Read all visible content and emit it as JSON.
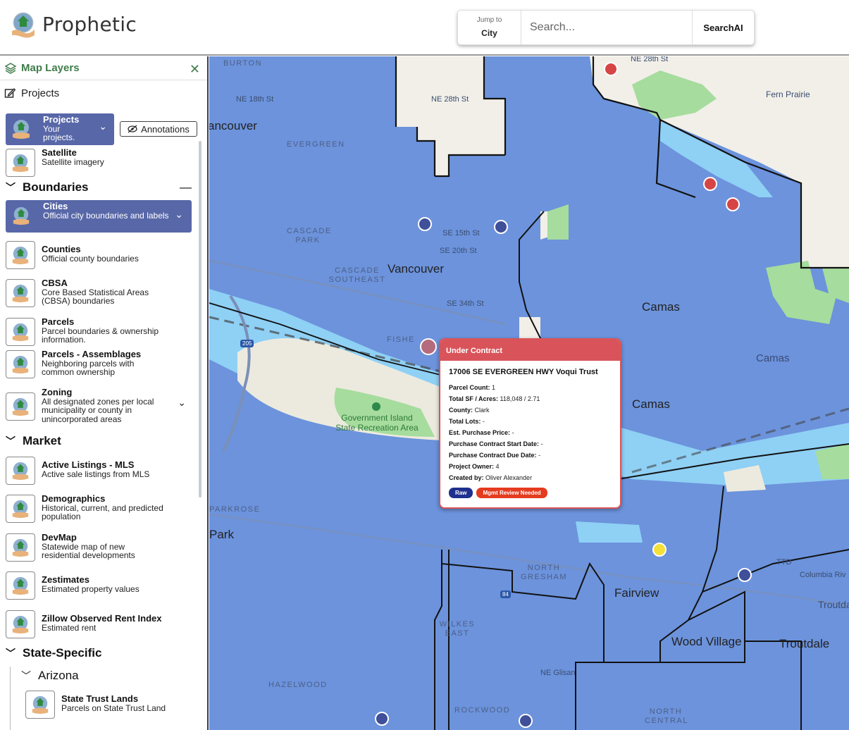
{
  "header": {
    "brand": "Prophetic",
    "jump_label": "Jump to",
    "jump_value": "City",
    "search_placeholder": "Search...",
    "searchai_label": "SearchAI"
  },
  "sidebar": {
    "title": "Map Layers",
    "projects_link": "Projects",
    "projects_layer": {
      "name": "Projects",
      "desc": "Your projects."
    },
    "annotations_button": "Annotations",
    "satellite": {
      "name": "Satellite",
      "desc": "Satellite imagery"
    },
    "sections": {
      "boundaries": "Boundaries",
      "market": "Market",
      "state_specific": "State-Specific",
      "arizona": "Arizona"
    },
    "boundaries": [
      {
        "name": "Cities",
        "desc": "Official city boundaries and labels"
      },
      {
        "name": "Counties",
        "desc": "Official county boundaries"
      },
      {
        "name": "CBSA",
        "desc": "Core Based Statistical Areas (CBSA) boundaries"
      },
      {
        "name": "Parcels",
        "desc": "Parcel boundaries & ownership information."
      },
      {
        "name": "Parcels - Assemblages",
        "desc": "Neighboring parcels with common ownership"
      },
      {
        "name": "Zoning",
        "desc": "All designated zones per local municipality or county in unincorporated areas"
      }
    ],
    "market": [
      {
        "name": "Active Listings - MLS",
        "desc": "Active sale listings from MLS"
      },
      {
        "name": "Demographics",
        "desc": "Historical, current, and predicted population"
      },
      {
        "name": "DevMap",
        "desc": "Statewide map of new residential developments"
      },
      {
        "name": "Zestimates",
        "desc": "Estimated property values"
      },
      {
        "name": "Zillow Observed Rent Index",
        "desc": "Estimated rent"
      }
    ],
    "arizona": [
      {
        "name": "State Trust Lands",
        "desc": "Parcels on State Trust Land"
      }
    ]
  },
  "map": {
    "labels": {
      "burton": "BURTON",
      "ne18": "NE 18th St",
      "ne28": "NE 28th St",
      "ne28b": "NE 28th St",
      "fern": "Fern Prairie",
      "vancouver_l": "ancouver",
      "evergreen": "EVERGREEN",
      "cascade": "CASCADE PARK",
      "se15": "SE 15th St",
      "se20": "SE 20th St",
      "vancouver": "Vancouver",
      "cascade_se": "CASCADE SOUTHEAST",
      "se34": "SE 34th St",
      "camas1": "Camas",
      "camas2": "Camas",
      "camas3": "Camas",
      "fisher": "FISHE",
      "govisland": "Government Island State Recreation Area",
      "parkrose": "PARKROSE",
      "park": "Park",
      "north_gresham": "NORTH GRESHAM",
      "fairview": "Fairview",
      "wilkes": "WILKES EAST",
      "wood_village": "Wood Village",
      "troutdale": "Troutdale",
      "troutdale2": "Troutdale",
      "ttd": "TTD",
      "columbia": "Columbia Riv",
      "ne_glisan": "NE Glisan",
      "hazelwood": "HAZELWOOD",
      "rockwood": "ROCKWOOD",
      "north_central": "NORTH CENTRAL",
      "i205": "205",
      "i84": "84"
    }
  },
  "popup": {
    "status": "Under Contract",
    "title": "17006 SE EVERGREEN HWY Voqui Trust",
    "rows": [
      {
        "label": "Parcel Count:",
        "value": "1"
      },
      {
        "label": "Total SF / Acres:",
        "value": "118,048 / 2.71"
      },
      {
        "label": "County:",
        "value": "Clark"
      },
      {
        "label": "Total Lots:",
        "value": "-"
      },
      {
        "label": "Est. Purchase Price:",
        "value": "-"
      },
      {
        "label": "Purchase Contract Start Date:",
        "value": "-"
      },
      {
        "label": "Purchase Contract Due Date:",
        "value": "-"
      },
      {
        "label": "Project Owner:",
        "value": "4"
      },
      {
        "label": "Created by:",
        "value": "Oliver Alexander"
      }
    ],
    "badges": [
      "Raw",
      "Mgmt Review Needed"
    ]
  },
  "colors": {
    "city_fill": "#6c93dc",
    "river": "#8fd0f5",
    "park": "#a6dc9d",
    "land": "#f3f1ea",
    "accent_green": "#3f7d4a",
    "selected_layer": "#5867a8",
    "popup_red": "#d9545a"
  }
}
